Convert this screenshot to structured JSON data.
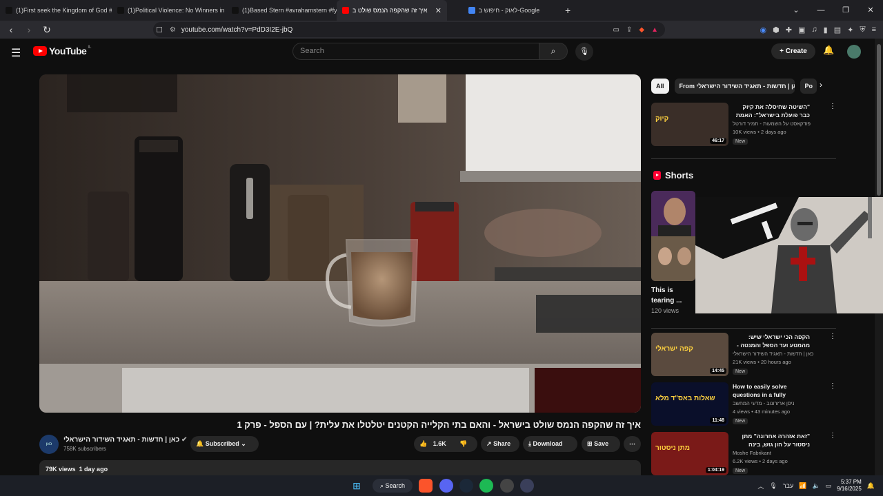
{
  "browser": {
    "tabs": [
      {
        "label": "(1)First seek the Kingdom of God #k",
        "fav": "#111",
        "active": false
      },
      {
        "label": "(1)Political Violence: No Winners in t",
        "fav": "#111",
        "active": false
      },
      {
        "label": "(1)Based Stern #avrahamstern #fyp #",
        "fav": "#111",
        "active": false
      },
      {
        "label": "איך זה שהקפה הנמס שולט ב",
        "fav": "#ff0000",
        "active": true
      },
      {
        "label": "לאוק - חיפוש ב-Google",
        "fav": "#4285f4",
        "active": false
      }
    ],
    "new_tab": "+",
    "url": "youtube.com/watch?v=PdD3I2E-jbQ",
    "window_controls": [
      "⌄",
      "—",
      "❐",
      "✕"
    ]
  },
  "youtube": {
    "logo_text": "YouTube",
    "region": "IL",
    "search_placeholder": "Search",
    "create_label": "Create"
  },
  "video": {
    "title": "איך זה שהקפה הנמס שולט בישראל - והאם בתי הקלייה הקטנים יטלטלו את עלית? | עם הספל - פרק 1",
    "channel_name": "כאן | חדשות - תאגיד השידור הישראלי",
    "channel_avatar_text": "כאן",
    "subscribers": "758K subscribers",
    "subscribed_label": "Subscribed",
    "likes": "1.6K",
    "share_label": "Share",
    "download_label": "Download",
    "save_label": "Save",
    "views": "79K views",
    "age": "1 day ago"
  },
  "sidebar": {
    "chips": [
      {
        "label": "All",
        "selected": true
      },
      {
        "label": "From כאן | חדשות - תאגיד השידור הישראלי",
        "selected": false
      },
      {
        "label": "Po",
        "selected": false
      }
    ],
    "recommendations": [
      {
        "title": "\"השיטה שחיסלה את קיוק כבר פועלת בישראל\": האמת המטרידה ...",
        "rtl": true,
        "channel": "פודקאסט על השמעות - תמיר דורטל",
        "meta": "10K views • 2 days ago",
        "badge": "New",
        "duration": "46:17",
        "thumb_text": "קיוק",
        "thumb_color": "#3a2e28"
      },
      {
        "title": "הקפה הכי ישראלי שיש: מהמטע ועד הספל והמנטה - 100% מישראל | עם ...",
        "rtl": true,
        "channel": "כאן | חדשות - תאגיד השידור הישראלי",
        "meta": "21K views • 20 hours ago",
        "badge": "New",
        "duration": "14:45",
        "thumb_text": "קפה ישראלי",
        "thumb_color": "#5a4a3e"
      },
      {
        "title": "How to easily solve questions in a fully deterministic finite ...",
        "rtl": false,
        "channel": "ניסן ארזרונוב - מדעי המחשב",
        "meta": "4 views • 43 minutes ago",
        "badge": "New",
        "duration": "11:48",
        "thumb_text": "שאלות באס\"ד מלא",
        "thumb_color": "#0a0f2a"
      },
      {
        "title": "\"זאת אזהרה אחרונה\" מתן ניסטור על הון גוש, בינה מלאכותית, יזמות ועתיד ...",
        "rtl": true,
        "channel": "Moshe Fabrikant",
        "meta": "6.2K views • 2 days ago",
        "badge": "New",
        "duration": "1:04:19",
        "thumb_text": "מתן ניסטור",
        "thumb_color": "#7a1a18"
      }
    ],
    "shorts_heading": "Shorts",
    "short": {
      "title": "This is tearing ...",
      "views": "120 views"
    }
  },
  "taskbar": {
    "search_label": "Search",
    "lang": "עבר",
    "time": "5:37 PM",
    "date": "9/16/2025"
  }
}
